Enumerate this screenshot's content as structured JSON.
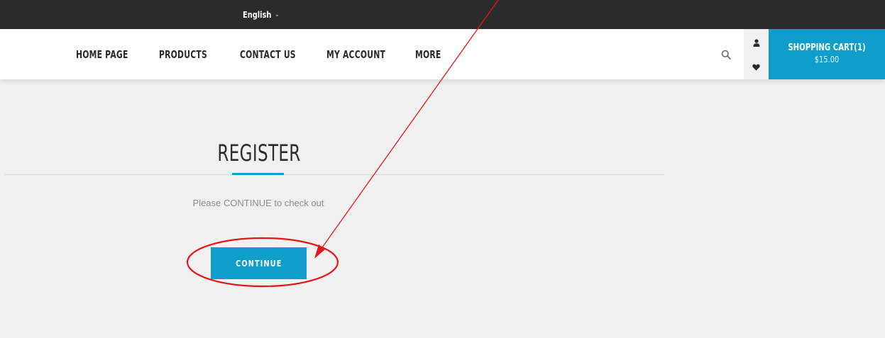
{
  "topbar": {
    "language": "English",
    "language_caret": "⌄"
  },
  "nav": {
    "items": [
      "HOME PAGE",
      "PRODUCTS",
      "CONTACT US",
      "MY ACCOUNT",
      "MORE"
    ]
  },
  "header_icons": {
    "search": "search-icon",
    "account": "user-icon",
    "wishlist": "heart-icon"
  },
  "cart": {
    "title": "SHOPPING CART(1)",
    "total": "$15.00"
  },
  "main": {
    "title": "REGISTER",
    "message": "Please CONTINUE to check out",
    "continue_label": "CONTINUE"
  },
  "annotation": {
    "arrow_color": "#e3171b",
    "circle_color": "#e3171b"
  },
  "colors": {
    "accent": "#0f9ecb",
    "topbar": "#2b2b2b",
    "content_bg": "#f0f0f0"
  }
}
